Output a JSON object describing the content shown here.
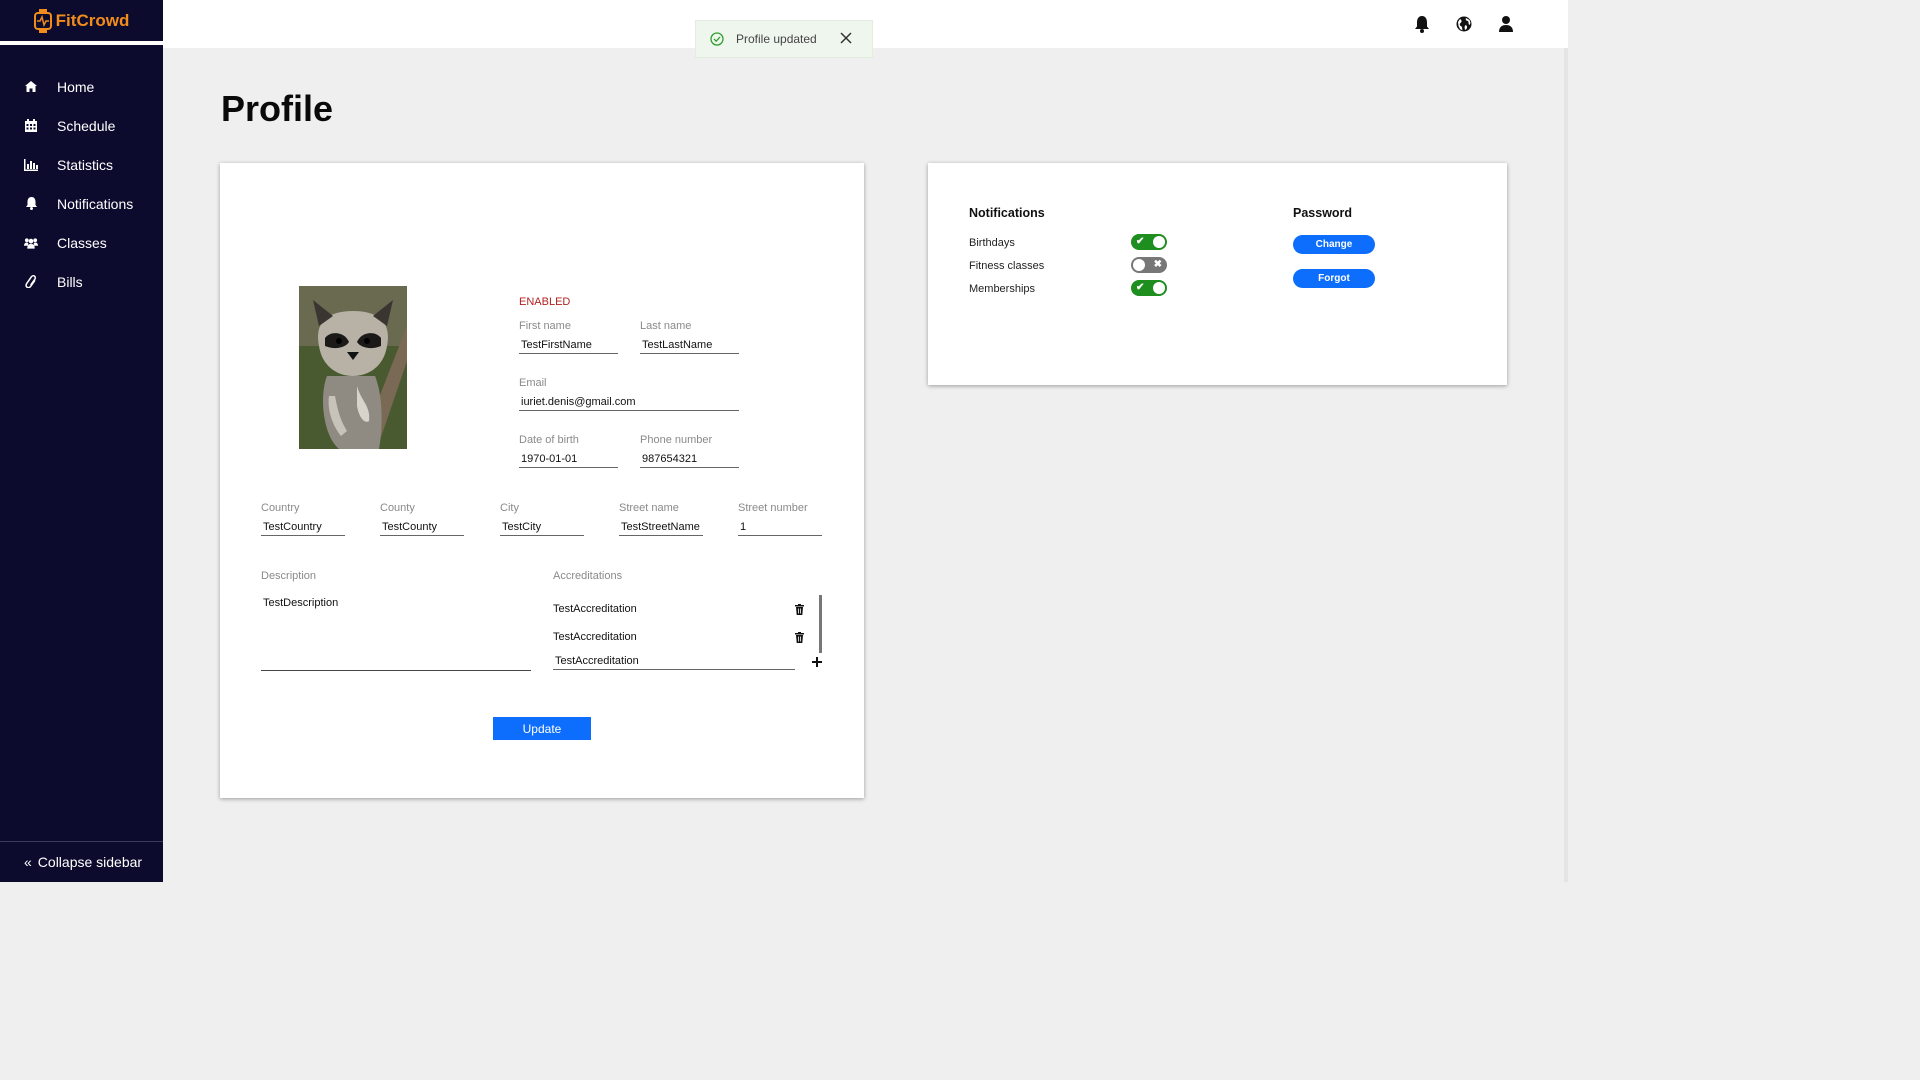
{
  "app": {
    "name": "FitCrowd",
    "brand_color": "#f28c1b",
    "sidebar_bg": "#0c0b2e",
    "accent": "#0d6efd"
  },
  "sidebar": {
    "items": [
      {
        "label": "Home",
        "icon": "home-icon"
      },
      {
        "label": "Schedule",
        "icon": "calendar-icon"
      },
      {
        "label": "Statistics",
        "icon": "bar-chart-icon"
      },
      {
        "label": "Notifications",
        "icon": "bell-icon"
      },
      {
        "label": "Classes",
        "icon": "users-icon"
      },
      {
        "label": "Bills",
        "icon": "paperclip-icon"
      }
    ],
    "collapse_label": "Collapse sidebar"
  },
  "topbar": {
    "icons": [
      "bell-icon",
      "globe-icon",
      "user-icon"
    ]
  },
  "toast": {
    "message": "Profile updated",
    "status_color": "#2e9e2e"
  },
  "page": {
    "title": "Profile"
  },
  "profile": {
    "status": "ENABLED",
    "first_name": {
      "label": "First name",
      "value": "TestFirstName"
    },
    "last_name": {
      "label": "Last name",
      "value": "TestLastName"
    },
    "email": {
      "label": "Email",
      "value": "iuriet.denis@gmail.com"
    },
    "dob": {
      "label": "Date of birth",
      "value": "1970-01-01"
    },
    "phone": {
      "label": "Phone number",
      "value": "987654321"
    },
    "country": {
      "label": "Country",
      "value": "TestCountry"
    },
    "county": {
      "label": "County",
      "value": "TestCounty"
    },
    "city": {
      "label": "City",
      "value": "TestCity"
    },
    "street_name": {
      "label": "Street name",
      "value": "TestStreetName"
    },
    "street_number": {
      "label": "Street number",
      "value": "1"
    },
    "description": {
      "label": "Description",
      "value": "TestDescription"
    },
    "accreditations": {
      "label": "Accreditations",
      "items": [
        "TestAccreditation",
        "TestAccreditation"
      ],
      "new_value": "TestAccreditation"
    },
    "update_label": "Update"
  },
  "settings": {
    "notifications_title": "Notifications",
    "notifications": [
      {
        "label": "Birthdays",
        "enabled": true
      },
      {
        "label": "Fitness classes",
        "enabled": false
      },
      {
        "label": "Memberships",
        "enabled": true
      }
    ],
    "password_title": "Password",
    "change_label": "Change",
    "forgot_label": "Forgot"
  }
}
